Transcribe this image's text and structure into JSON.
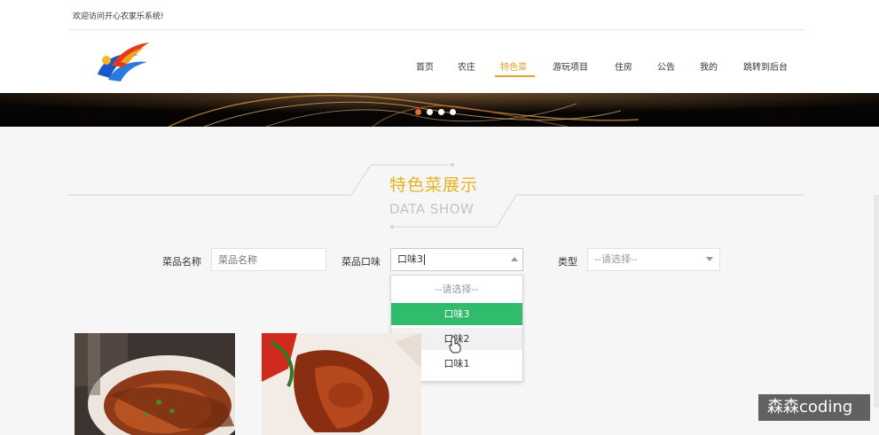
{
  "header": {
    "welcome": "欢迎访问开心农家乐系统!"
  },
  "nav": {
    "items": [
      {
        "label": "首页",
        "active": false
      },
      {
        "label": "农庄",
        "active": false
      },
      {
        "label": "特色菜",
        "active": true
      },
      {
        "label": "游玩项目",
        "active": false
      },
      {
        "label": "住房",
        "active": false
      },
      {
        "label": "公告",
        "active": false
      },
      {
        "label": "我的",
        "active": false
      },
      {
        "label": "跳转到后台",
        "active": false
      }
    ]
  },
  "section": {
    "title": "特色菜展示",
    "subtitle": "DATA SHOW"
  },
  "filters": {
    "name": {
      "label": "菜品名称",
      "placeholder": "菜品名称",
      "value": ""
    },
    "taste": {
      "label": "菜品口味",
      "value": "口味3"
    },
    "type": {
      "label": "类型",
      "value": "--请选择--"
    }
  },
  "dropdown": {
    "options": [
      {
        "label": "--请选择--",
        "state": "placeholder"
      },
      {
        "label": "口味3",
        "state": "selected"
      },
      {
        "label": "口味2",
        "state": "hover"
      },
      {
        "label": "口味1",
        "state": "normal"
      }
    ]
  },
  "watermark": "森森coding",
  "colors": {
    "accent": "#e2a324",
    "selected": "#31bb6c",
    "title": "#e5b320"
  }
}
